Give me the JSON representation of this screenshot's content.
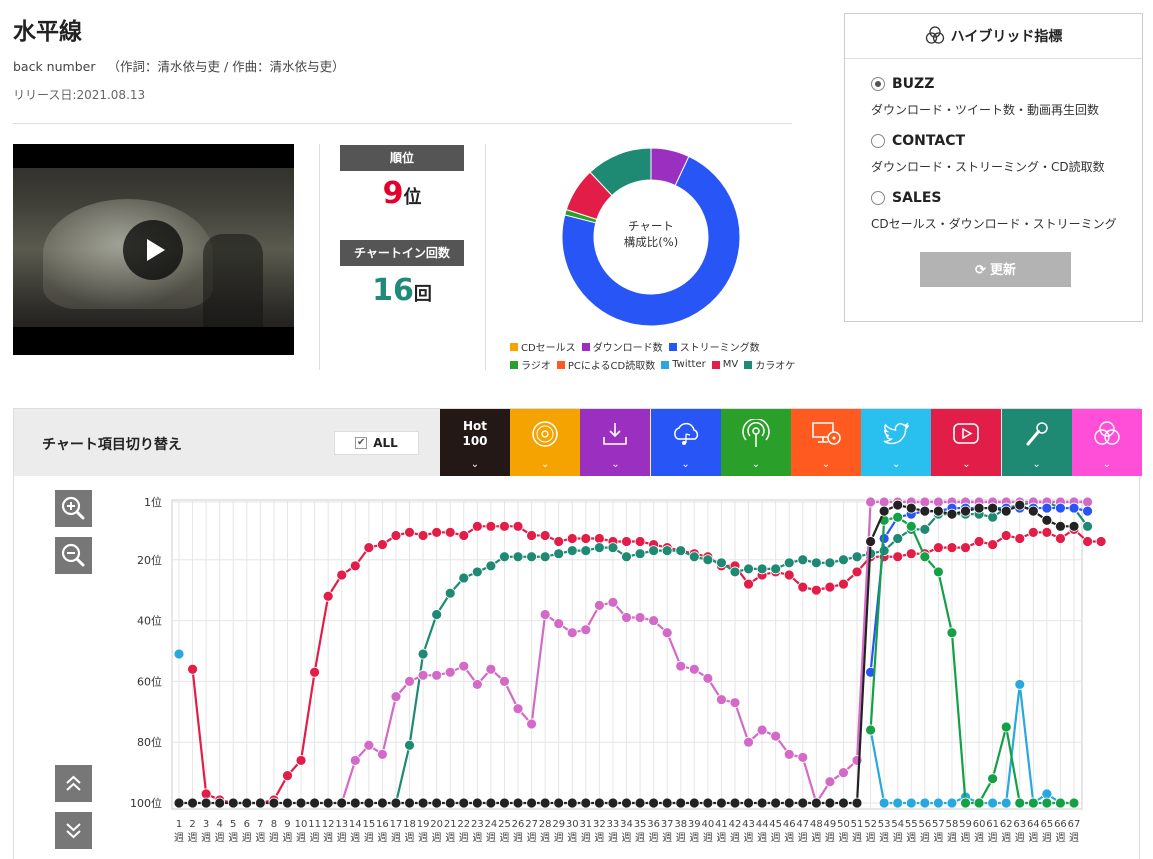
{
  "song": {
    "title": "水平線",
    "artist": "back number",
    "credits": "（作詞：清水依与吏 / 作曲：清水依与吏）",
    "release": "リリース日:2021.08.13"
  },
  "stats": {
    "rank_label": "順位",
    "rank_value": "9",
    "rank_unit": "位",
    "chartin_label": "チャートイン回数",
    "chartin_value": "16",
    "chartin_unit": "回",
    "rank_color": "#e4002b",
    "chartin_color": "#1f8a78"
  },
  "donut": {
    "center_line1": "チャート",
    "center_line2": "構成比(%)",
    "slices": [
      {
        "name": "ダウンロード数",
        "value": 7,
        "color": "#9b2fc0"
      },
      {
        "name": "ストリーミング数",
        "value": 72,
        "color": "#2855f5"
      },
      {
        "name": "ラジオ",
        "value": 1,
        "color": "#2aa02a"
      },
      {
        "name": "MV",
        "value": 8,
        "color": "#e11d48"
      },
      {
        "name": "カラオケ",
        "value": 12,
        "color": "#1e8a74"
      }
    ],
    "legend_row1": [
      {
        "name": "CDセールス",
        "color": "#f5a300"
      },
      {
        "name": "ダウンロード数",
        "color": "#9b2fc0"
      },
      {
        "name": "ストリーミング数",
        "color": "#2855f5"
      }
    ],
    "legend_row2": [
      {
        "name": "ラジオ",
        "color": "#2aa02a"
      },
      {
        "name": "PCによるCD読取数",
        "color": "#ff5a1f"
      },
      {
        "name": "Twitter",
        "color": "#29a8e0"
      },
      {
        "name": "MV",
        "color": "#e11d48"
      },
      {
        "name": "カラオケ",
        "color": "#1e8a74"
      }
    ]
  },
  "hybrid": {
    "title": "ハイブリッド指標",
    "options": [
      {
        "label": "BUZZ",
        "desc": "ダウンロード・ツイート数・動画再生回数",
        "selected": true
      },
      {
        "label": "CONTACT",
        "desc": "ダウンロード・ストリーミング・CD読取数",
        "selected": false
      },
      {
        "label": "SALES",
        "desc": "CDセールス・ダウンロード・ストリーミング",
        "selected": false
      }
    ],
    "update_label": "更新"
  },
  "chart_switch": {
    "label": "チャート項目切り替え",
    "all_label": "ALL",
    "all_checked": true,
    "hot_line1": "Hot",
    "hot_line2": "100",
    "tabs": [
      {
        "name": "hot100",
        "color": "#231815",
        "icon": "hot100"
      },
      {
        "name": "cd-sales",
        "color": "#f5a300",
        "icon": "disc-icon"
      },
      {
        "name": "download",
        "color": "#9b2fc0",
        "icon": "download-icon"
      },
      {
        "name": "streaming",
        "color": "#2855f5",
        "icon": "cloud-music-icon"
      },
      {
        "name": "radio",
        "color": "#2aa02a",
        "icon": "radio-icon"
      },
      {
        "name": "pc-cd-read",
        "color": "#ff5a1f",
        "icon": "pc-disc-icon"
      },
      {
        "name": "twitter",
        "color": "#29c0f0",
        "icon": "twitter-icon"
      },
      {
        "name": "mv",
        "color": "#e11d48",
        "icon": "play-icon"
      },
      {
        "name": "karaoke",
        "color": "#1e8a74",
        "icon": "microphone-icon"
      },
      {
        "name": "hybrid",
        "color": "#ff4fd8",
        "icon": "hybrid-icon"
      }
    ]
  },
  "chart_data": {
    "type": "line",
    "xlabel": "",
    "ylabel": "",
    "x_categories": [
      "1",
      "2",
      "3",
      "4",
      "5",
      "6",
      "7",
      "8",
      "9",
      "10",
      "11",
      "12",
      "13",
      "14",
      "15",
      "16",
      "17",
      "18",
      "19",
      "20",
      "21",
      "22",
      "23",
      "24",
      "25",
      "26",
      "27",
      "28",
      "29",
      "30",
      "31",
      "32",
      "33",
      "34",
      "35",
      "36",
      "37",
      "38",
      "39",
      "40",
      "41",
      "42",
      "43",
      "44",
      "45",
      "46",
      "47",
      "48",
      "49",
      "50",
      "51",
      "52",
      "53",
      "54",
      "55",
      "56",
      "57",
      "58",
      "59",
      "60",
      "61",
      "62",
      "63",
      "64",
      "65",
      "66",
      "67"
    ],
    "x_unit": "週",
    "y_ticks": [
      "1位",
      "20位",
      "40位",
      "60位",
      "80位",
      "100位"
    ],
    "y_tick_values": [
      1,
      20,
      40,
      60,
      80,
      100
    ],
    "ylim": [
      1,
      100
    ],
    "y_inverted": true,
    "grid": true,
    "series": [
      {
        "key": "mv",
        "color": "#e11d48",
        "values": [
          null,
          56,
          97,
          99,
          100,
          100,
          100,
          99,
          91,
          86,
          57,
          32,
          25,
          22,
          16,
          15,
          12,
          11,
          12,
          11,
          11,
          12,
          9,
          9,
          9,
          9,
          12,
          12,
          14,
          13,
          13,
          13,
          14,
          14,
          14,
          15,
          16,
          17,
          18,
          19,
          22,
          22,
          28,
          25,
          24,
          25,
          29,
          30,
          29,
          28,
          24,
          19,
          19,
          19,
          18,
          18,
          16,
          16,
          16,
          14,
          15,
          12,
          13,
          11,
          11,
          13,
          10,
          14,
          14
        ]
      },
      {
        "key": "karaoke",
        "color": "#1e8a74",
        "values": [
          null,
          null,
          null,
          null,
          null,
          null,
          null,
          null,
          null,
          null,
          null,
          null,
          null,
          null,
          null,
          null,
          100,
          81,
          51,
          38,
          31,
          26,
          24,
          22,
          19,
          19,
          19,
          19,
          18,
          17,
          17,
          16,
          16,
          19,
          18,
          17,
          17,
          17,
          19,
          20,
          21,
          24,
          23,
          23,
          23,
          21,
          20,
          21,
          21,
          20,
          19,
          18,
          17,
          13,
          10,
          10,
          5,
          5,
          5,
          5,
          6,
          3,
          2,
          1,
          1,
          3,
          3,
          9
        ]
      },
      {
        "key": "download",
        "color": "#d36ac7",
        "values": [
          null,
          null,
          null,
          null,
          null,
          null,
          null,
          null,
          null,
          null,
          null,
          null,
          100,
          86,
          81,
          84,
          65,
          60,
          58,
          58,
          57,
          55,
          61,
          56,
          60,
          69,
          74,
          38,
          41,
          44,
          43,
          35,
          34,
          39,
          39,
          40,
          44,
          55,
          56,
          59,
          66,
          67,
          80,
          76,
          78,
          84,
          85,
          100,
          93,
          90,
          86,
          1,
          1,
          1,
          1,
          1,
          1,
          1,
          1,
          1,
          1,
          1,
          1,
          1,
          1,
          1,
          1,
          1
        ]
      },
      {
        "key": "streaming",
        "color": "#2855f5",
        "values": [
          null,
          null,
          null,
          null,
          null,
          null,
          null,
          null,
          null,
          null,
          null,
          null,
          null,
          null,
          null,
          null,
          null,
          null,
          null,
          null,
          null,
          null,
          null,
          null,
          null,
          null,
          null,
          null,
          null,
          null,
          null,
          null,
          null,
          null,
          null,
          null,
          null,
          null,
          null,
          null,
          null,
          null,
          null,
          null,
          null,
          null,
          null,
          null,
          null,
          null,
          null,
          57,
          13,
          6,
          5,
          4,
          4,
          3,
          3,
          3,
          3,
          3,
          3,
          3,
          3,
          3,
          3,
          4
        ]
      },
      {
        "key": "twitter",
        "color": "#29a8e0",
        "values": [
          51,
          null,
          null,
          null,
          null,
          null,
          null,
          null,
          null,
          null,
          null,
          null,
          null,
          null,
          null,
          null,
          null,
          null,
          null,
          null,
          null,
          null,
          null,
          null,
          null,
          null,
          null,
          null,
          null,
          null,
          null,
          null,
          null,
          null,
          null,
          null,
          null,
          null,
          null,
          null,
          null,
          null,
          null,
          null,
          null,
          null,
          null,
          null,
          null,
          null,
          null,
          76,
          100,
          100,
          100,
          100,
          100,
          100,
          98,
          100,
          100,
          100,
          61,
          100,
          97,
          100
        ]
      },
      {
        "key": "radio",
        "color": "#13a046",
        "values": [
          null,
          null,
          null,
          null,
          null,
          null,
          null,
          null,
          null,
          null,
          null,
          null,
          null,
          null,
          null,
          null,
          null,
          null,
          null,
          null,
          null,
          null,
          null,
          null,
          null,
          null,
          null,
          null,
          null,
          null,
          null,
          null,
          null,
          null,
          null,
          null,
          null,
          null,
          null,
          null,
          null,
          null,
          null,
          null,
          null,
          null,
          null,
          null,
          null,
          null,
          null,
          76,
          7,
          6,
          9,
          19,
          24,
          44,
          100,
          100,
          92,
          75,
          100,
          100,
          100,
          100,
          100
        ]
      },
      {
        "key": "hot100",
        "color": "#222222",
        "values": [
          100,
          100,
          100,
          100,
          100,
          100,
          100,
          100,
          100,
          100,
          100,
          100,
          100,
          100,
          100,
          100,
          100,
          100,
          100,
          100,
          100,
          100,
          100,
          100,
          100,
          100,
          100,
          100,
          100,
          100,
          100,
          100,
          100,
          100,
          100,
          100,
          100,
          100,
          100,
          100,
          100,
          100,
          100,
          100,
          100,
          100,
          100,
          100,
          100,
          100,
          100,
          14,
          4,
          2,
          3,
          4,
          4,
          5,
          4,
          3,
          3,
          4,
          2,
          4,
          7,
          9,
          9
        ]
      }
    ]
  }
}
